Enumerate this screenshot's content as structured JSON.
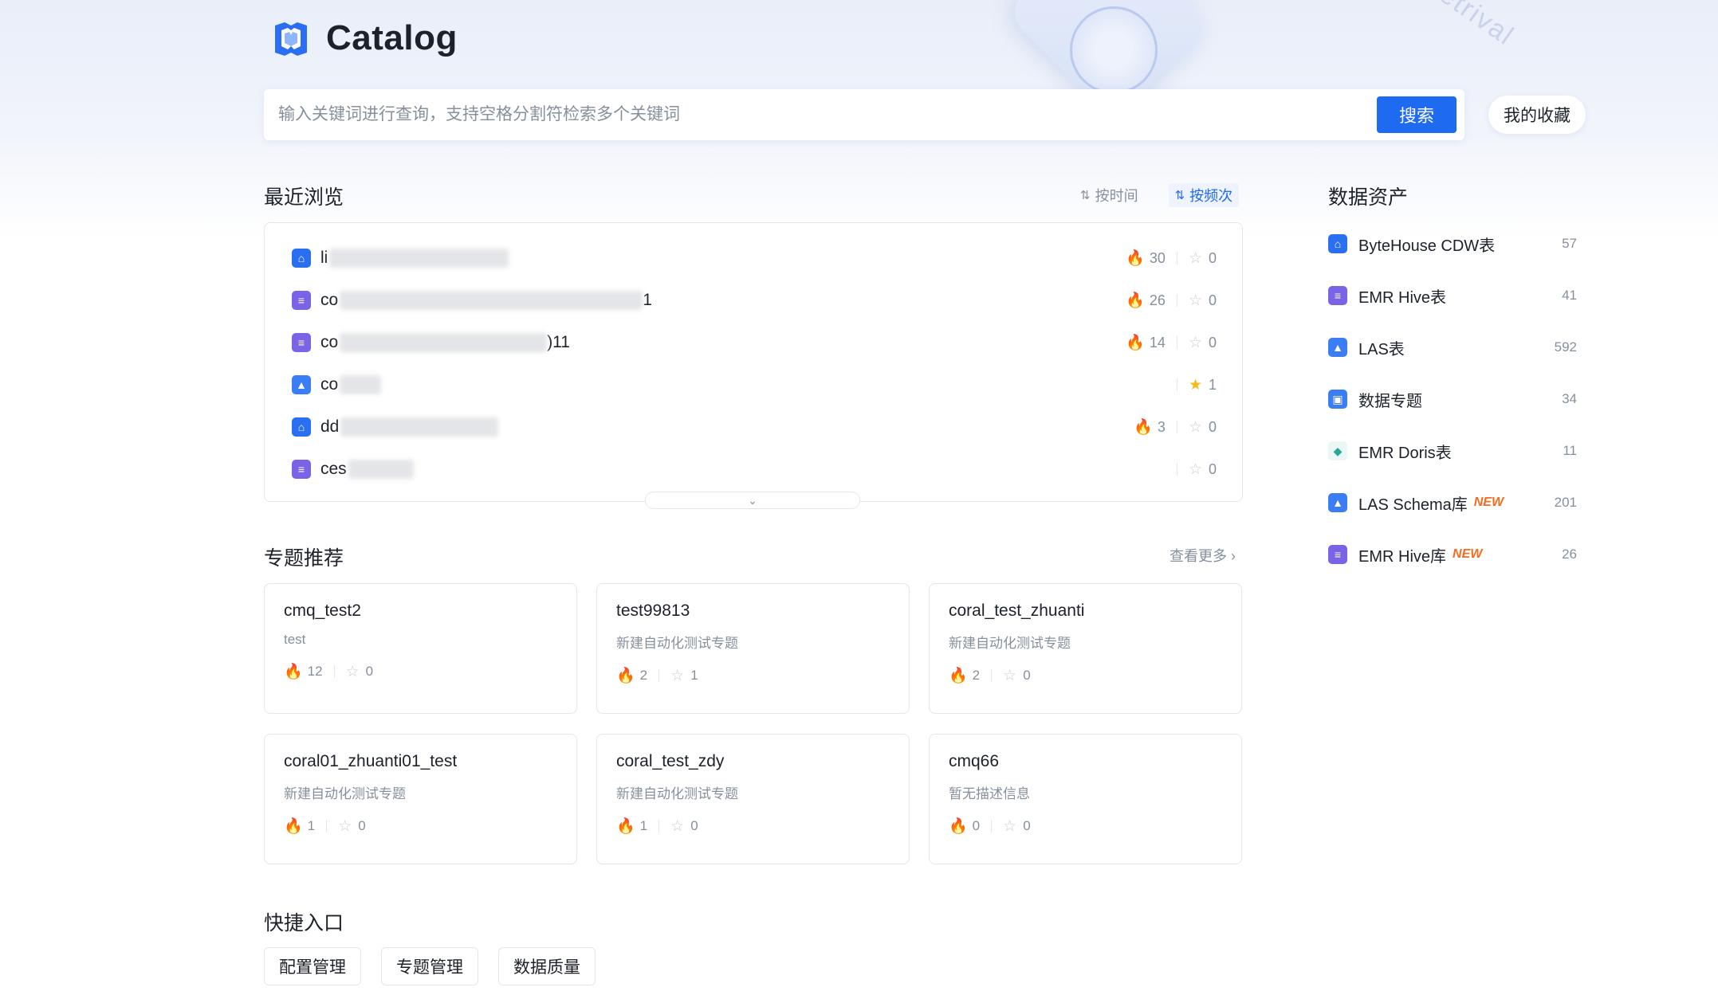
{
  "header": {
    "title": "Catalog",
    "search_placeholder": "输入关键词进行查询，支持空格分割符检索多个关键词",
    "search_button": "搜索",
    "favorites_button": "我的收藏"
  },
  "recent": {
    "title": "最近浏览",
    "sort_by_time": "按时间",
    "sort_by_frequency": "按频次",
    "items": [
      {
        "prefix": "li",
        "icon": "bytehouse-icon",
        "views": "30",
        "stars": "0"
      },
      {
        "prefix": "co",
        "suffix": "1",
        "icon": "emr-hive-icon",
        "views": "26",
        "stars": "0"
      },
      {
        "prefix": "co",
        "suffix": ")11",
        "icon": "emr-hive-icon",
        "views": "14",
        "stars": "0"
      },
      {
        "prefix": "co",
        "icon": "las-icon",
        "views": "",
        "stars": "1"
      },
      {
        "prefix": "dd",
        "icon": "bytehouse-icon",
        "views": "3",
        "stars": "0"
      },
      {
        "prefix": "ces",
        "icon": "emr-hive-icon",
        "views": "",
        "stars": "0"
      }
    ]
  },
  "topics": {
    "title": "专题推荐",
    "more": "查看更多",
    "cards": [
      {
        "name": "cmq_test2",
        "desc": "test",
        "views": "12",
        "stars": "0"
      },
      {
        "name": "test99813",
        "desc": "新建自动化测试专题",
        "views": "2",
        "stars": "1"
      },
      {
        "name": "coral_test_zhuanti",
        "desc": "新建自动化测试专题",
        "views": "2",
        "stars": "0"
      },
      {
        "name": "coral01_zhuanti01_test",
        "desc": "新建自动化测试专题",
        "views": "1",
        "stars": "0"
      },
      {
        "name": "coral_test_zdy",
        "desc": "新建自动化测试专题",
        "views": "1",
        "stars": "0"
      },
      {
        "name": "cmq66",
        "desc": "暂无描述信息",
        "views": "0",
        "stars": "0"
      }
    ]
  },
  "shortcuts": {
    "title": "快捷入口",
    "items": [
      "配置管理",
      "专题管理",
      "数据质量"
    ]
  },
  "assets": {
    "title": "数据资产",
    "items": [
      {
        "label": "ByteHouse CDW表",
        "count": "57",
        "badge": "",
        "icon": "bytehouse-icon"
      },
      {
        "label": "EMR Hive表",
        "count": "41",
        "badge": "",
        "icon": "emr-hive-icon"
      },
      {
        "label": "LAS表",
        "count": "592",
        "badge": "",
        "icon": "las-icon"
      },
      {
        "label": "数据专题",
        "count": "34",
        "badge": "",
        "icon": "topic-icon"
      },
      {
        "label": "EMR Doris表",
        "count": "11",
        "badge": "",
        "icon": "doris-icon"
      },
      {
        "label": "LAS Schema库",
        "count": "201",
        "badge": "NEW",
        "icon": "las-icon"
      },
      {
        "label": "EMR Hive库",
        "count": "26",
        "badge": "NEW",
        "icon": "emr-hive-icon"
      }
    ]
  },
  "colors": {
    "primary": "#1e6af0",
    "flame": "#f3464a",
    "star_active": "#f7ba1e",
    "new_badge": "#f56b1f"
  }
}
